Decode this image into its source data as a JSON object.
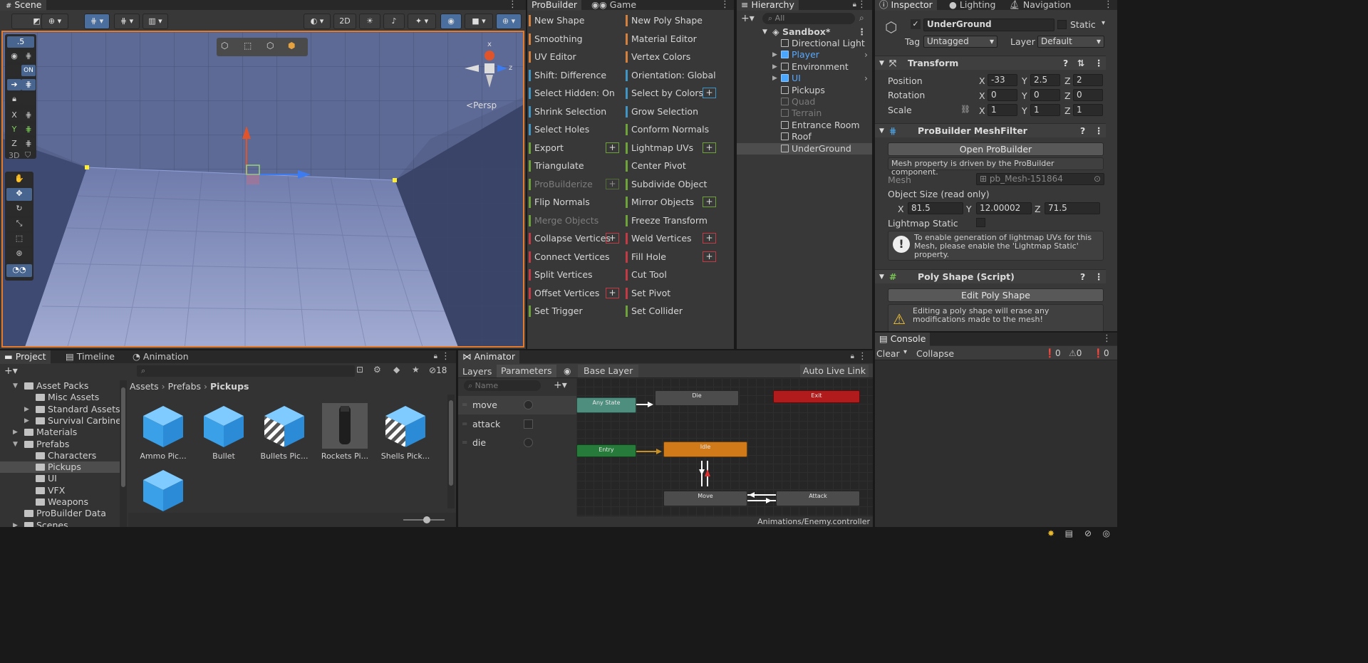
{
  "scene": {
    "tab": "Scene",
    "toolbar": {
      "btn_2d": "2D"
    },
    "snap_value": ".5",
    "vis_on_label": "ON",
    "axis_labels": [
      "X",
      "Y",
      "Z"
    ],
    "mode_3d": "3D",
    "persp_label": "Persp",
    "gizmo_axes": {
      "x": "x",
      "z": "z"
    }
  },
  "probuilder": {
    "tabs": [
      "ProBuilder",
      "Game"
    ],
    "left_items": [
      {
        "label": "New Shape",
        "color": "#d5803d",
        "plus": false,
        "dim": false
      },
      {
        "label": "Smoothing",
        "color": "#d5803d",
        "plus": false,
        "dim": false
      },
      {
        "label": "UV Editor",
        "color": "#d5803d",
        "plus": false,
        "dim": false
      },
      {
        "label": "Shift: Difference",
        "color": "#3f95c6",
        "plus": false,
        "dim": false
      },
      {
        "label": "Select Hidden: On",
        "color": "#3f95c6",
        "plus": false,
        "dim": false
      },
      {
        "label": "Shrink Selection",
        "color": "#3f95c6",
        "plus": false,
        "dim": false
      },
      {
        "label": "Select Holes",
        "color": "#3f95c6",
        "plus": false,
        "dim": false
      },
      {
        "label": "Export",
        "color": "#6ea33a",
        "plus": true,
        "dim": false
      },
      {
        "label": "Triangulate",
        "color": "#6ea33a",
        "plus": false,
        "dim": false
      },
      {
        "label": "ProBuilderize",
        "color": "#6ea33a",
        "plus": true,
        "dim": true
      },
      {
        "label": "Flip Normals",
        "color": "#6ea33a",
        "plus": false,
        "dim": false
      },
      {
        "label": "Merge Objects",
        "color": "#6ea33a",
        "plus": false,
        "dim": true
      },
      {
        "label": "Collapse Vertices",
        "color": "#c33a45",
        "plus": true,
        "dim": false
      },
      {
        "label": "Connect Vertices",
        "color": "#c33a45",
        "plus": false,
        "dim": false
      },
      {
        "label": "Split Vertices",
        "color": "#c33a45",
        "plus": false,
        "dim": false
      },
      {
        "label": "Offset Vertices",
        "color": "#c33a45",
        "plus": true,
        "dim": false
      },
      {
        "label": "Set Trigger",
        "color": "#6ea33a",
        "plus": false,
        "dim": false
      }
    ],
    "right_items": [
      {
        "label": "New Poly Shape",
        "color": "#d5803d",
        "plus": false,
        "dim": false
      },
      {
        "label": "Material Editor",
        "color": "#d5803d",
        "plus": false,
        "dim": false
      },
      {
        "label": "Vertex Colors",
        "color": "#d5803d",
        "plus": false,
        "dim": false
      },
      {
        "label": "Orientation: Global",
        "color": "#3f95c6",
        "plus": false,
        "dim": false
      },
      {
        "label": "Select by Colors",
        "color": "#3f95c6",
        "plus": true,
        "dim": false
      },
      {
        "label": "Grow Selection",
        "color": "#3f95c6",
        "plus": false,
        "dim": false
      },
      {
        "label": "Conform Normals",
        "color": "#6ea33a",
        "plus": false,
        "dim": false
      },
      {
        "label": "Lightmap UVs",
        "color": "#6ea33a",
        "plus": true,
        "dim": false
      },
      {
        "label": "Center Pivot",
        "color": "#6ea33a",
        "plus": false,
        "dim": false
      },
      {
        "label": "Subdivide Object",
        "color": "#6ea33a",
        "plus": false,
        "dim": false
      },
      {
        "label": "Mirror Objects",
        "color": "#6ea33a",
        "plus": true,
        "dim": false
      },
      {
        "label": "Freeze Transform",
        "color": "#6ea33a",
        "plus": false,
        "dim": false
      },
      {
        "label": "Weld Vertices",
        "color": "#c33a45",
        "plus": true,
        "dim": false
      },
      {
        "label": "Fill Hole",
        "color": "#c33a45",
        "plus": true,
        "dim": false
      },
      {
        "label": "Cut Tool",
        "color": "#c33a45",
        "plus": false,
        "dim": false
      },
      {
        "label": "Set Pivot",
        "color": "#c33a45",
        "plus": false,
        "dim": false
      },
      {
        "label": "Set Collider",
        "color": "#6ea33a",
        "plus": false,
        "dim": false
      }
    ]
  },
  "hierarchy": {
    "tab": "Hierarchy",
    "search_placeholder": "All",
    "scene_name": "Sandbox*",
    "items": [
      {
        "label": "Directional Light",
        "type": "normal"
      },
      {
        "label": "Player",
        "type": "prefab"
      },
      {
        "label": "Environment",
        "type": "normal"
      },
      {
        "label": "UI",
        "type": "prefab"
      },
      {
        "label": "Pickups",
        "type": "normal"
      },
      {
        "label": "Quad",
        "type": "dim"
      },
      {
        "label": "Terrain",
        "type": "dim"
      },
      {
        "label": "Entrance Room",
        "type": "normal"
      },
      {
        "label": "Roof",
        "type": "normal"
      },
      {
        "label": "UnderGround",
        "type": "selected"
      }
    ]
  },
  "inspector": {
    "tabs": [
      "Inspector",
      "Lighting",
      "Navigation"
    ],
    "object_name": "UnderGround",
    "static_label": "Static",
    "tag_label": "Tag",
    "tag_value": "Untagged",
    "layer_label": "Layer",
    "layer_value": "Default",
    "transform": {
      "title": "Transform",
      "position_label": "Position",
      "rotation_label": "Rotation",
      "scale_label": "Scale",
      "position": [
        "-33",
        "2.5",
        "2"
      ],
      "rotation": [
        "0",
        "0",
        "0"
      ],
      "scale": [
        "1",
        "1",
        "1"
      ],
      "axes": [
        "X",
        "Y",
        "Z"
      ]
    },
    "meshfilter": {
      "title": "ProBuilder MeshFilter",
      "open_button": "Open ProBuilder",
      "info": "Mesh property is driven by the ProBuilder component.",
      "mesh_label": "Mesh",
      "mesh_value": "pb_Mesh-151864",
      "size_label": "Object Size (read only)",
      "size": [
        "81.5",
        "12.00002",
        "71.5"
      ],
      "lightmap_label": "Lightmap Static",
      "lightmap_warning": "To enable generation of lightmap UVs for this Mesh, please enable the 'Lightmap Static' property."
    },
    "polyshape": {
      "title": "Poly Shape (Script)",
      "edit_button": "Edit Poly Shape",
      "warning": "Editing a poly shape will erase any modifications made to the mesh!"
    }
  },
  "console": {
    "tab": "Console",
    "clear": "Clear",
    "collapse": "Collapse",
    "counts": [
      "0",
      "0",
      "0"
    ]
  },
  "project": {
    "tabs": [
      "Project",
      "Timeline",
      "Animation"
    ],
    "hidden_count": "18",
    "breadcrumb": [
      "Assets",
      "Prefabs",
      "Pickups"
    ],
    "tree": [
      {
        "label": "Asset Packs",
        "indent": 0,
        "arrow": "open"
      },
      {
        "label": "Misc Assets",
        "indent": 1,
        "arrow": "none"
      },
      {
        "label": "Standard Assets",
        "indent": 1,
        "arrow": "closed"
      },
      {
        "label": "Survival Carbine",
        "indent": 1,
        "arrow": "closed"
      },
      {
        "label": "Materials",
        "indent": 0,
        "arrow": "closed"
      },
      {
        "label": "Prefabs",
        "indent": 0,
        "arrow": "open"
      },
      {
        "label": "Characters",
        "indent": 1,
        "arrow": "none"
      },
      {
        "label": "Pickups",
        "indent": 1,
        "arrow": "none"
      },
      {
        "label": "UI",
        "indent": 1,
        "arrow": "none"
      },
      {
        "label": "VFX",
        "indent": 1,
        "arrow": "none"
      },
      {
        "label": "Weapons",
        "indent": 1,
        "arrow": "none"
      },
      {
        "label": "ProBuilder Data",
        "indent": 0,
        "arrow": "none"
      },
      {
        "label": "Scenes",
        "indent": 0,
        "arrow": "closed"
      }
    ],
    "assets": [
      {
        "label": "Ammo Pic...",
        "icon": "blue-cube"
      },
      {
        "label": "Bullet",
        "icon": "blue-cube"
      },
      {
        "label": "Bullets Pic...",
        "icon": "striped-cube"
      },
      {
        "label": "Rockets Pi...",
        "icon": "rocket"
      },
      {
        "label": "Shells Pick...",
        "icon": "striped-cube"
      },
      {
        "label": "",
        "icon": "blue-cube"
      }
    ]
  },
  "animator": {
    "tab": "Animator",
    "subtabs": [
      "Layers",
      "Parameters"
    ],
    "layer_name": "Base Layer",
    "auto_live_link": "Auto Live Link",
    "name_placeholder": "Name",
    "params": [
      {
        "name": "move",
        "kind": "bool"
      },
      {
        "name": "attack",
        "kind": "trigger"
      },
      {
        "name": "die",
        "kind": "bool"
      }
    ],
    "states": {
      "any_state": "Any State",
      "die": "Die",
      "exit": "Exit",
      "entry": "Entry",
      "idle": "Idle",
      "move": "Move",
      "attack": "Attack"
    },
    "controller_path": "Animations/Enemy.controller"
  }
}
